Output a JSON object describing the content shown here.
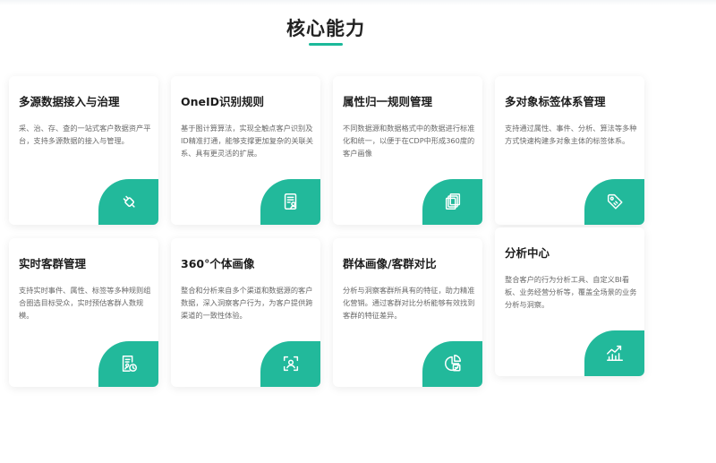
{
  "section": {
    "title": "核心能力"
  },
  "accent_color": "#22b99b",
  "cards": [
    {
      "title": "多源数据接入与治理",
      "desc": "采、治、存、查的一站式客户数据资产平台，支持多源数据的接入与管理。",
      "icon": "plug-icon"
    },
    {
      "title": "OneID识别规则",
      "desc": "基于图计算算法，实现全触点客户识别及ID精准打通，能够支撑更加复杂的关联关系、具有更灵活的扩展。",
      "icon": "id-card-icon"
    },
    {
      "title": "属性归一规则管理",
      "desc": "不同数据源和数据格式中的数据进行标准化和统一，以便于在CDP中形成360度的客户画像",
      "icon": "layers-icon"
    },
    {
      "title": "多对象标签体系管理",
      "desc": "支持通过属性、事件、分析、算法等多种方式快速构建多对象主体的标签体系。",
      "icon": "tag-icon"
    },
    {
      "title": "实时客群管理",
      "desc": "支持实时事件、属性、标签等多种规则组合圈选目标受众，实时预估客群人数规模。",
      "icon": "document-clock-icon"
    },
    {
      "title": "360°个体画像",
      "desc": "整合和分析来自多个渠道和数据源的客户数据，深入洞察客户行为，为客户提供跨渠道的一致性体验。",
      "icon": "face-scan-icon"
    },
    {
      "title": "群体画像/客群对比",
      "desc": "分析与洞察客群所具有的特征，助力精准化营销。通过客群对比分析能够有效找到客群的特征差异。",
      "icon": "pie-compare-icon"
    },
    {
      "title": "分析中心",
      "desc": "整合客户的行为分析工具、自定义BI看板、业务经营分析等，覆盖全场景的业务分析与洞察。",
      "icon": "trend-chart-icon"
    }
  ]
}
